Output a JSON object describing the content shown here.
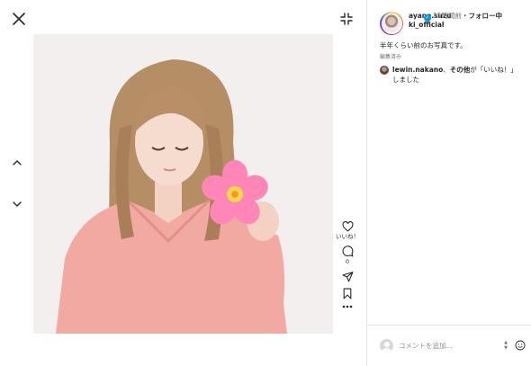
{
  "post": {
    "username": "ayane.suzuki_official",
    "username_line1": "ayane.suzu",
    "username_line2": "ki_official",
    "verified_glyph": "✓",
    "time_ago": "15時間前",
    "dot": "・",
    "follow_status": "フォロー中",
    "caption": "半年くらい前のお写真です。",
    "edited_label": "編集済み"
  },
  "likes": {
    "user": "lewin.nakano",
    "separator": "、",
    "others": "その他",
    "suffix": "が「いいね！」しました"
  },
  "actions": {
    "like_count": "いいね！",
    "comment_count": "0"
  },
  "comment": {
    "placeholder": "コメントを追加..."
  },
  "icons": {
    "close": "close-icon",
    "minimize": "minimize-icon",
    "prev": "chevron-up-icon",
    "next": "chevron-down-icon",
    "like": "heart-icon",
    "comment": "comment-icon",
    "share": "send-icon",
    "save": "bookmark-icon",
    "more": "more-icon",
    "emoji": "emoji-icon"
  },
  "colors": {
    "verified": "#0095f6",
    "secondary_text": "#737373",
    "photo_background": "#f3efef",
    "sticker_flower": "#ff7fae"
  }
}
